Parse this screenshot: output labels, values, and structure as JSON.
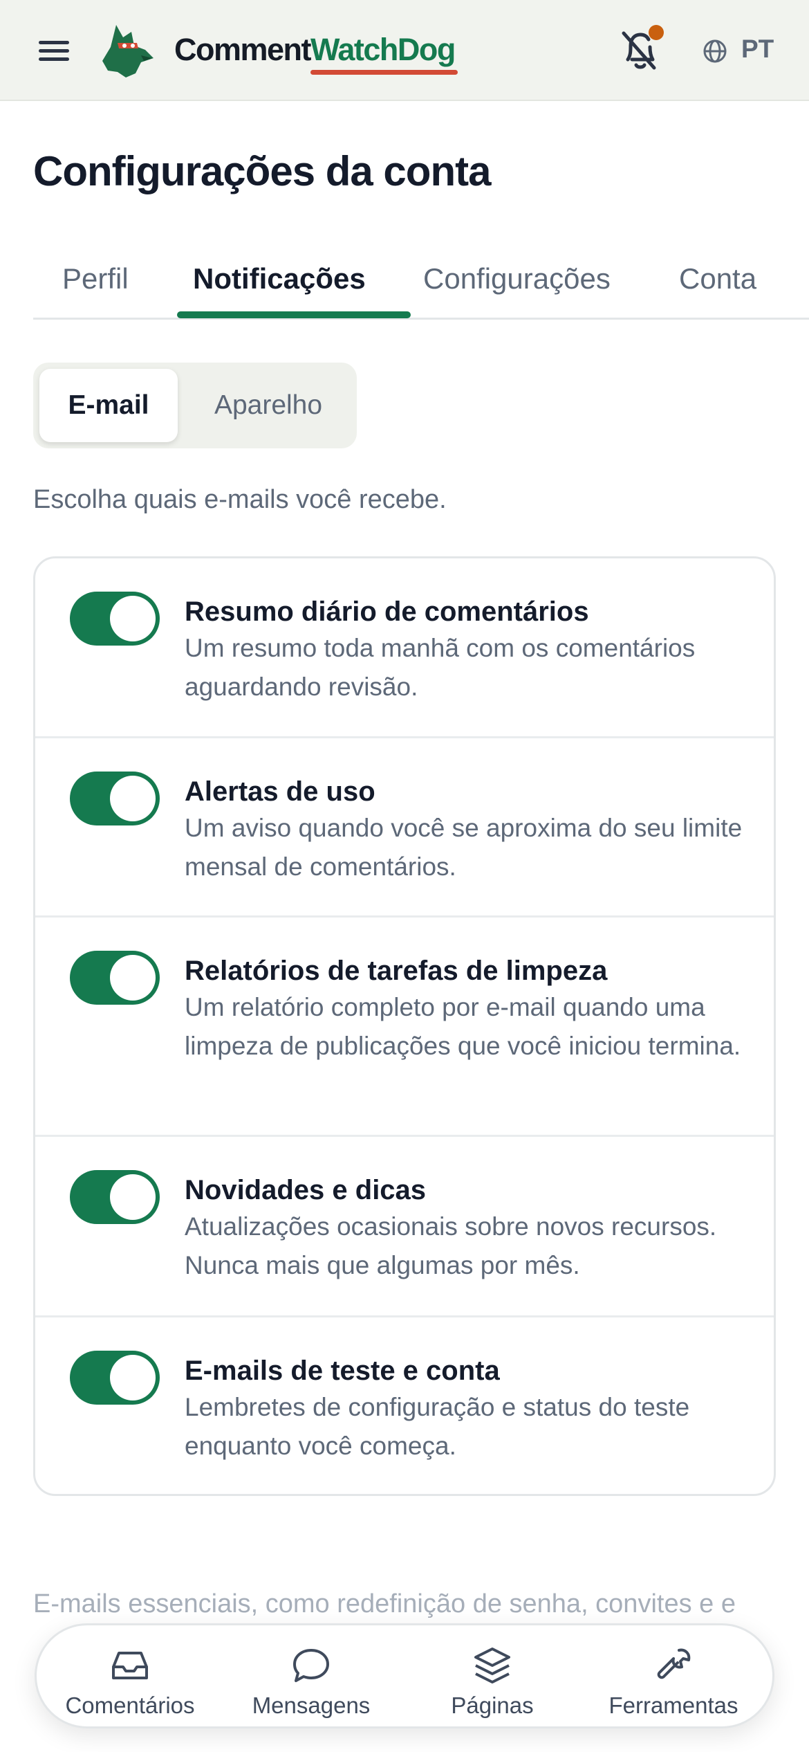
{
  "header": {
    "menu_icon": "hamburger-menu-icon",
    "logo_icon": "dog-mascot-logo",
    "logo_text_part1": "Comment",
    "logo_text_part2": "WatchDog",
    "bell_icon": "bell-off-icon",
    "globe_icon": "globe-icon",
    "language": "PT",
    "colors": {
      "brand_green": "#157a4f",
      "accent_red": "#d24a35",
      "notification_dot": "#c9600f"
    }
  },
  "page": {
    "title": "Configurações da conta"
  },
  "tabs": [
    {
      "label": "Perfil",
      "active": false
    },
    {
      "label": "Notificações",
      "active": true
    },
    {
      "label": "Configurações",
      "active": false
    },
    {
      "label": "Conta",
      "active": false
    }
  ],
  "channel_switch": {
    "email_label": "E-mail",
    "device_label": "Aparelho",
    "selected": "E-mail"
  },
  "intro_text": "Escolha quais e-mails você recebe.",
  "notifications": [
    {
      "title": "Resumo diário de comentários",
      "description": "Um resumo toda manhã com os comentários aguardando revisão.",
      "enabled": true
    },
    {
      "title": "Alertas de uso",
      "description": "Um aviso quando você se aproxima do seu limite mensal de comentários.",
      "enabled": true
    },
    {
      "title": "Relatórios de tarefas de limpeza",
      "description": "Um relatório completo por e-mail quando uma limpeza de publicações que você iniciou termina.",
      "enabled": true
    },
    {
      "title": "Novidades e dicas",
      "description": "Atualizações ocasionais sobre novos recursos. Nunca mais que algumas por mês.",
      "enabled": true
    },
    {
      "title": "E-mails de teste e conta",
      "description": "Lembretes de configuração e status do teste enquanto você começa.",
      "enabled": true
    }
  ],
  "footnote": "E-mails essenciais, como redefinição de senha, convites e e",
  "bottom_nav": [
    {
      "label": "Comentários",
      "icon": "inbox-icon"
    },
    {
      "label": "Mensagens",
      "icon": "chat-bubble-icon"
    },
    {
      "label": "Páginas",
      "icon": "layers-icon"
    },
    {
      "label": "Ferramentas",
      "icon": "wrench-icon"
    }
  ]
}
